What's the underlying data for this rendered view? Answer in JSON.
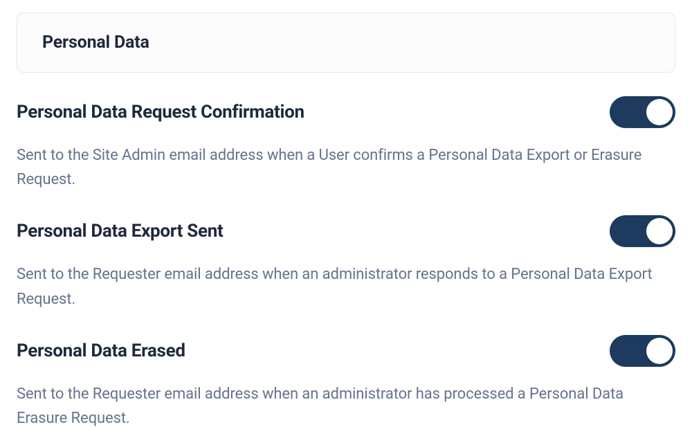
{
  "section": {
    "title": "Personal Data"
  },
  "settings": {
    "request_confirmation": {
      "title": "Personal Data Request Confirmation",
      "description": "Sent to the Site Admin email address when a User confirms a Personal Data Export or Erasure Request.",
      "enabled": true
    },
    "export_sent": {
      "title": "Personal Data Export Sent",
      "description": "Sent to the Requester email address when an administrator responds to a Personal Data Export Request.",
      "enabled": true
    },
    "data_erased": {
      "title": "Personal Data Erased",
      "description": "Sent to the Requester email address when an administrator has processed a Personal Data Erasure Request.",
      "enabled": true
    }
  }
}
